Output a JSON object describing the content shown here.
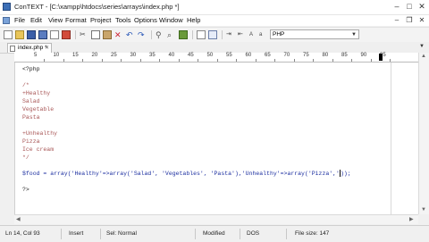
{
  "window": {
    "title": "ConTEXT - [C:\\xampp\\htdocs\\series\\arrays\\index.php *]"
  },
  "menu": [
    "File",
    "Edit",
    "View",
    "Format",
    "Project",
    "Tools",
    "Options",
    "Window",
    "Help"
  ],
  "toolbar": {
    "highlighter_value": "PHP",
    "icons": [
      "new-file",
      "open-folder",
      "save",
      "save-all",
      "close",
      "cut",
      "copy",
      "paste",
      "delete",
      "undo",
      "redo",
      "find",
      "search-replace",
      "find-next",
      "bookmark",
      "print",
      "preview",
      "indent",
      "outdent",
      "case-upper",
      "case-lower"
    ]
  },
  "tab": {
    "label": "index.php *"
  },
  "ruler": {
    "labels": [
      "5",
      "10",
      "15",
      "20",
      "25",
      "30",
      "35",
      "40",
      "45",
      "50",
      "55",
      "60",
      "65",
      "70",
      "75",
      "80",
      "85",
      "90",
      "95"
    ]
  },
  "code": [
    {
      "text": "<?php",
      "kind": "default"
    },
    {
      "text": "",
      "kind": "default"
    },
    {
      "text": "/*",
      "kind": "comment"
    },
    {
      "text": "+Healthy",
      "kind": "comment"
    },
    {
      "text": "Salad",
      "kind": "comment"
    },
    {
      "text": "Vegetable",
      "kind": "comment"
    },
    {
      "text": "Pasta",
      "kind": "comment"
    },
    {
      "text": "",
      "kind": "comment"
    },
    {
      "text": "+Unhealthy",
      "kind": "comment"
    },
    {
      "text": "Pizza",
      "kind": "comment"
    },
    {
      "text": "Ice cream",
      "kind": "comment"
    },
    {
      "text": "*/",
      "kind": "comment"
    },
    {
      "text": "",
      "kind": "default"
    },
    {
      "text": "$food = array('Healthy'=>array('Salad', 'Vegetables', 'Pasta'),'Unhealthy'=>array('Pizza','",
      "kind": "code",
      "after_caret": "));"
    },
    {
      "text": "",
      "kind": "default"
    },
    {
      "text": "?>",
      "kind": "default"
    }
  ],
  "status": {
    "position": "Ln 14, Col 93",
    "mode": "Insert",
    "selection": "Sel: Normal",
    "modified": "Modified",
    "format": "DOS",
    "filesize": "File size: 147"
  }
}
